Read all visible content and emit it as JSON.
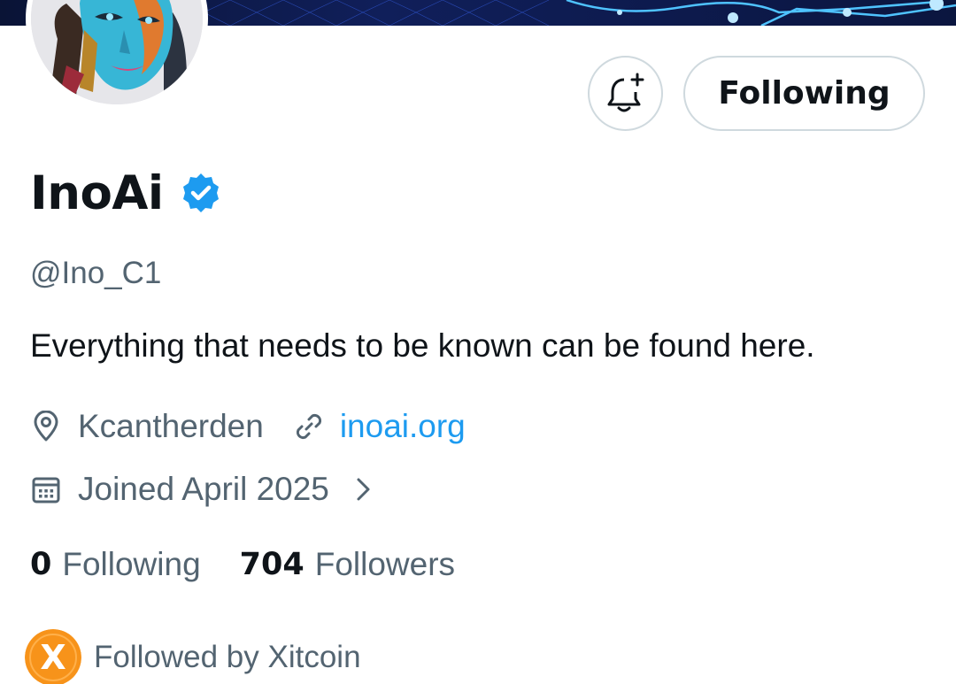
{
  "profile": {
    "display_name": "InoAi",
    "handle": "@Ino_C1",
    "bio": "Everything that needs to be known can be found here.",
    "location": "Kcantherden",
    "website": "inoai.org",
    "joined": "Joined April 2025",
    "verified": true,
    "avatar_icon": "robot-face-portrait"
  },
  "actions": {
    "follow_label": "Following",
    "notify_icon": "bell-plus-icon"
  },
  "stats": {
    "following_count": "0",
    "following_label": "Following",
    "followers_count": "704",
    "followers_label": "Followers"
  },
  "followed_by": {
    "text": "Followed by Xitcoin",
    "avatar_letter": "X"
  },
  "colors": {
    "link": "#1d9bf0",
    "verified": "#1d9bf0",
    "secondary_text": "#536471",
    "border": "#cfd9de",
    "banner": "#101f5a",
    "xitcoin_orange": "#f7931a"
  }
}
